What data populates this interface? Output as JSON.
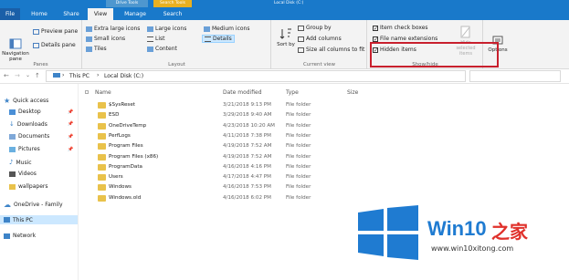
{
  "tabbar": {
    "drive_tools": "Drive Tools",
    "search_tools": "Search Tools",
    "window_title": "Local Disk (C:)",
    "tabs": [
      "File",
      "Home",
      "Share",
      "View",
      "Manage",
      "Search"
    ]
  },
  "ribbon": {
    "panes": {
      "navigation_pane": "Navigation pane",
      "preview_pane": "Preview pane",
      "details_pane": "Details pane",
      "label": "Panes"
    },
    "layout": {
      "items": [
        "Extra large icons",
        "Large icons",
        "Medium icons",
        "Small icons",
        "List",
        "Details",
        "Tiles",
        "Content"
      ],
      "label": "Layout"
    },
    "current_view": {
      "sort": "Sort by",
      "group": "Group by",
      "add_columns": "Add columns",
      "size_cols": "Size all columns to fit",
      "label": "Current view"
    },
    "show_hide": {
      "item_checkboxes": "Item check boxes",
      "file_ext": "File name extensions",
      "hidden_items": "Hidden items",
      "hide_selected": "Hide selected items",
      "label": "Show/hide"
    },
    "options": "Options"
  },
  "address": {
    "crumbs": [
      "This PC",
      "Local Disk (C:)"
    ]
  },
  "nav": {
    "items": [
      "Quick access",
      "Desktop",
      "Downloads",
      "Documents",
      "Pictures",
      "Music",
      "Videos",
      "wallpapers",
      "OneDrive - Family",
      "This PC",
      "Network"
    ]
  },
  "columns": [
    "Name",
    "Date modified",
    "Type",
    "Size"
  ],
  "files": [
    {
      "name": "$SysReset",
      "date": "3/21/2018 9:13 PM",
      "type": "File folder"
    },
    {
      "name": "ESD",
      "date": "3/29/2018 9:40 AM",
      "type": "File folder"
    },
    {
      "name": "OneDriveTemp",
      "date": "4/23/2018 10:20 AM",
      "type": "File folder"
    },
    {
      "name": "PerfLogs",
      "date": "4/11/2018 7:38 PM",
      "type": "File folder"
    },
    {
      "name": "Program Files",
      "date": "4/19/2018 7:52 AM",
      "type": "File folder"
    },
    {
      "name": "Program Files (x86)",
      "date": "4/19/2018 7:52 AM",
      "type": "File folder"
    },
    {
      "name": "ProgramData",
      "date": "4/16/2018 4:16 PM",
      "type": "File folder"
    },
    {
      "name": "Users",
      "date": "4/17/2018 4:47 PM",
      "type": "File folder"
    },
    {
      "name": "Windows",
      "date": "4/16/2018 7:53 PM",
      "type": "File folder"
    },
    {
      "name": "Windows.old",
      "date": "4/16/2018 6:02 PM",
      "type": "File folder"
    }
  ],
  "watermark": {
    "brand": "Win10",
    "suffix": "之家",
    "url": "www.win10xitong.com"
  },
  "colors": {
    "accent": "#1979ca",
    "file_tab": "#1a5fa8",
    "folder": "#e9c24b",
    "highlight": "#c8202d",
    "logo": "#1f7bd1"
  }
}
